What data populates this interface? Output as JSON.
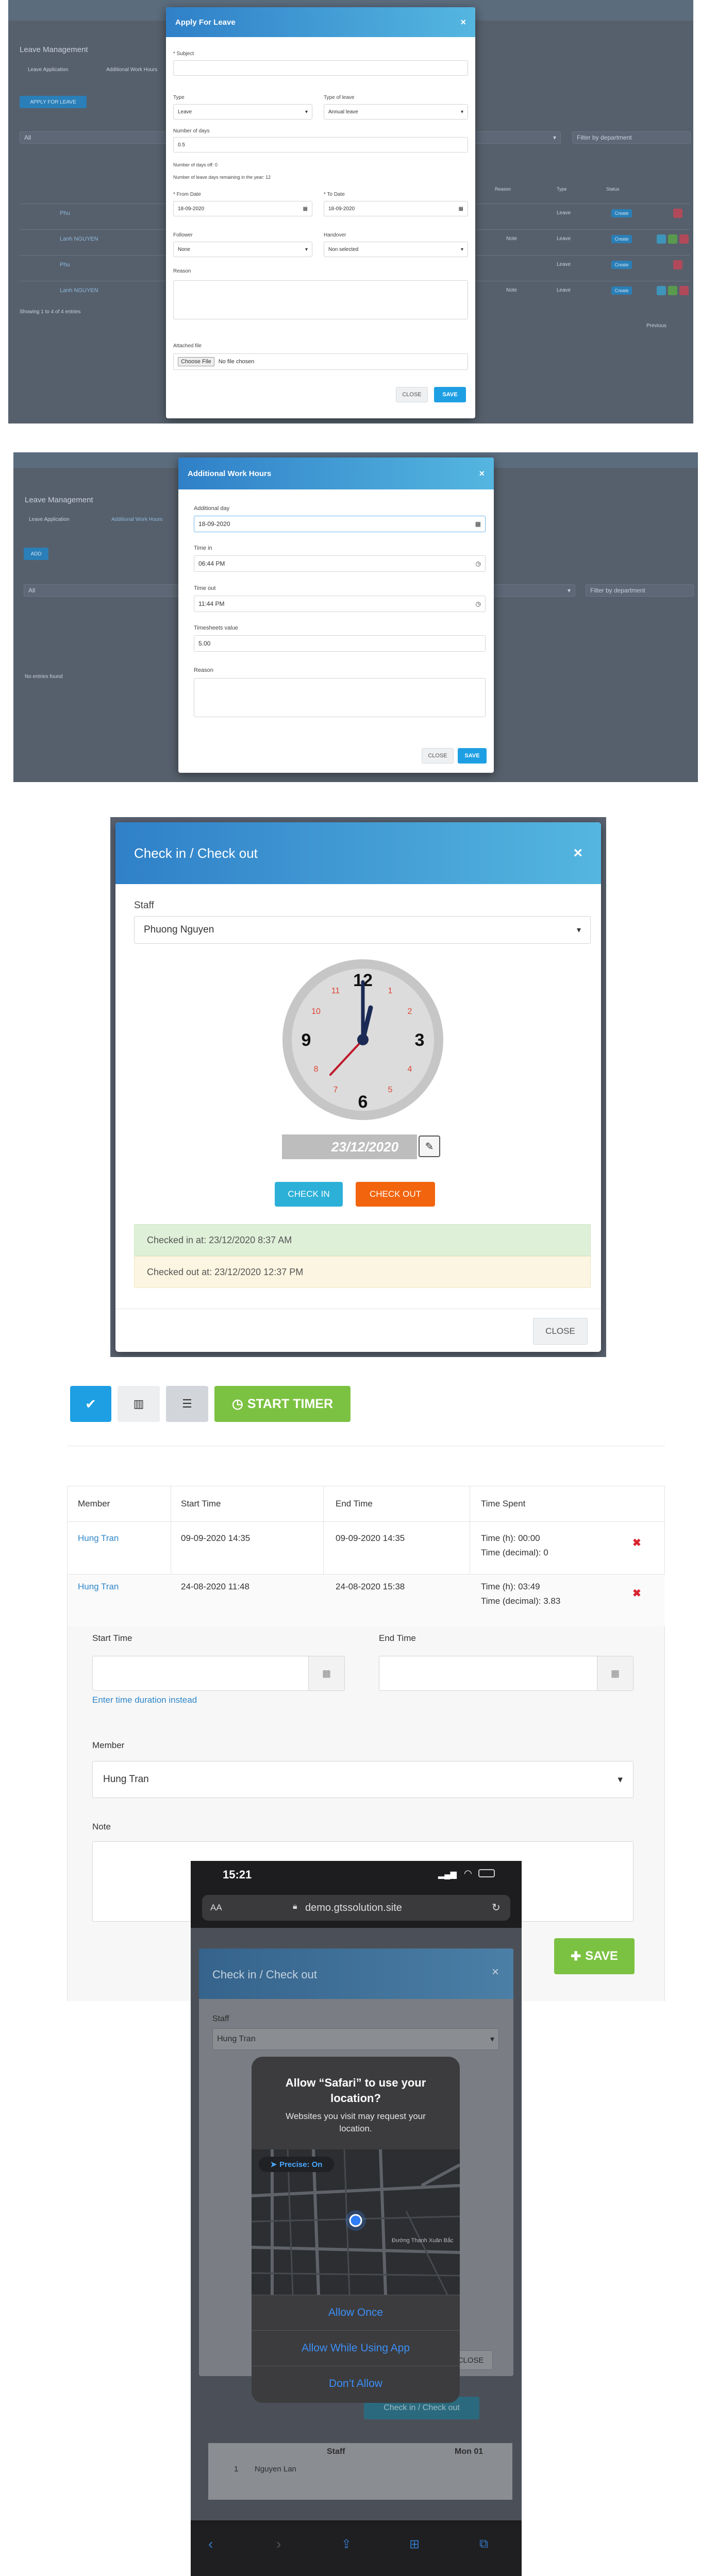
{
  "leave_screen": {
    "page_title": "Leave Management",
    "tabs": [
      "Leave Application",
      "Additional Work Hours"
    ],
    "apply_button": "APPLY FOR LEAVE",
    "filter_all": "All",
    "filter_department": "Filter by department",
    "showing": "Showing 1 to 4 of 4 entries",
    "col_reason": "Reason",
    "col_type": "Type",
    "col_status": "Status",
    "rows": [
      {
        "name": "Phu",
        "reason": "",
        "type": "Leave",
        "status": "Create"
      },
      {
        "name": "Lanh NGUYEN",
        "reason": "Note",
        "type": "Leave",
        "status": "Create"
      },
      {
        "name": "Phu",
        "reason": "",
        "type": "Leave",
        "status": "Create"
      },
      {
        "name": "Lanh NGUYEN",
        "reason": "Note",
        "type": "Leave",
        "status": "Create"
      }
    ],
    "pager_prev": "Previous",
    "modal": {
      "title": "Apply For Leave",
      "close_x": "×",
      "subject_label": "* Subject",
      "subject_value": "",
      "type_label": "Type",
      "type_value": "Leave",
      "type_of_leave_label": "Type of leave",
      "type_of_leave_value": "Annual leave",
      "days_label": "Number of days",
      "days_value": "0.5",
      "days_off_text": "Number of days off: 0",
      "remaining_text": "Number of leave days remaining in the year: 12",
      "from_label": "* From Date",
      "from_value": "18-09-2020",
      "to_label": "* To Date",
      "to_value": "18-09-2020",
      "follower_label": "Follower",
      "follower_value": "None",
      "handover_label": "Handover",
      "handover_value": "Non selected",
      "reason_label": "Reason",
      "attached_label": "Attached file",
      "choose_file": "Choose File",
      "no_file": "No file chosen",
      "close_btn": "CLOSE",
      "save_btn": "SAVE"
    }
  },
  "work_hours_screen": {
    "page_title": "Leave Management",
    "tabs": [
      "Leave Application",
      "Additional Work Hours"
    ],
    "add_button": "ADD",
    "filter_all": "All",
    "filter_department": "Filter by department",
    "no_entries": "No entries found",
    "modal": {
      "title": "Additional Work Hours",
      "close_x": "×",
      "day_label": "Additional day",
      "day_value": "18-09-2020",
      "time_in_label": "Time in",
      "time_in_value": "06:44 PM",
      "time_out_label": "Time out",
      "time_out_value": "11:44 PM",
      "timesheets_label": "Timesheets value",
      "timesheets_value": "5.00",
      "reason_label": "Reason",
      "close_btn": "CLOSE",
      "save_btn": "SAVE"
    }
  },
  "checkin_screen": {
    "title": "Check in / Check out",
    "close_x": "×",
    "staff_label": "Staff",
    "staff_value": "Phuong Nguyen",
    "clock_numbers": [
      "12",
      "1",
      "2",
      "3",
      "4",
      "5",
      "6",
      "7",
      "8",
      "9",
      "10",
      "11"
    ],
    "date_value": "23/12/2020",
    "check_in_btn": "CHECK IN",
    "check_out_btn": "CHECK OUT",
    "checked_in_text": "Checked in at: 23/12/2020 8:37 AM",
    "checked_out_text": "Checked out at: 23/12/2020 12:37 PM",
    "close_btn": "CLOSE"
  },
  "timer_screen": {
    "start_timer": "START TIMER",
    "col_member": "Member",
    "col_start": "Start Time",
    "col_end": "End Time",
    "col_spent": "Time Spent",
    "rows": [
      {
        "member": "Hung Tran",
        "start": "09-09-2020 14:35",
        "end": "09-09-2020 14:35",
        "spent_h": "Time (h): 00:00",
        "spent_dec": "Time (decimal): 0"
      },
      {
        "member": "Hung Tran",
        "start": "24-08-2020 11:48",
        "end": "24-08-2020 15:38",
        "spent_h": "Time (h): 03:49",
        "spent_dec": "Time (decimal): 3.83"
      }
    ],
    "form": {
      "start_label": "Start Time",
      "end_label": "End Time",
      "duration_link": "Enter time duration instead",
      "member_label": "Member",
      "member_value": "Hung Tran",
      "note_label": "Note",
      "save_btn": "SAVE"
    }
  },
  "phone_screen": {
    "time": "15:21",
    "url_aa": "AA",
    "url": "demo.gtssolution.site",
    "modal_title": "Check in / Check out",
    "staff_label": "Staff",
    "staff_value": "Hung Tran",
    "alert_title": "Allow “Safari” to use your location?",
    "alert_message": "Websites you visit may request your location.",
    "precise": "Precise: On",
    "map_label": "Đường Thanh Xuân Bắc",
    "allow_once": "Allow Once",
    "allow_while": "Allow While Using App",
    "dont_allow": "Don’t Allow",
    "close_btn": "CLOSE",
    "bg_button": "Check in / Check out",
    "table_staff": "Staff",
    "table_mon": "Mon 01",
    "table_row_no": "1",
    "table_row_name": "Nguyen Lan"
  }
}
